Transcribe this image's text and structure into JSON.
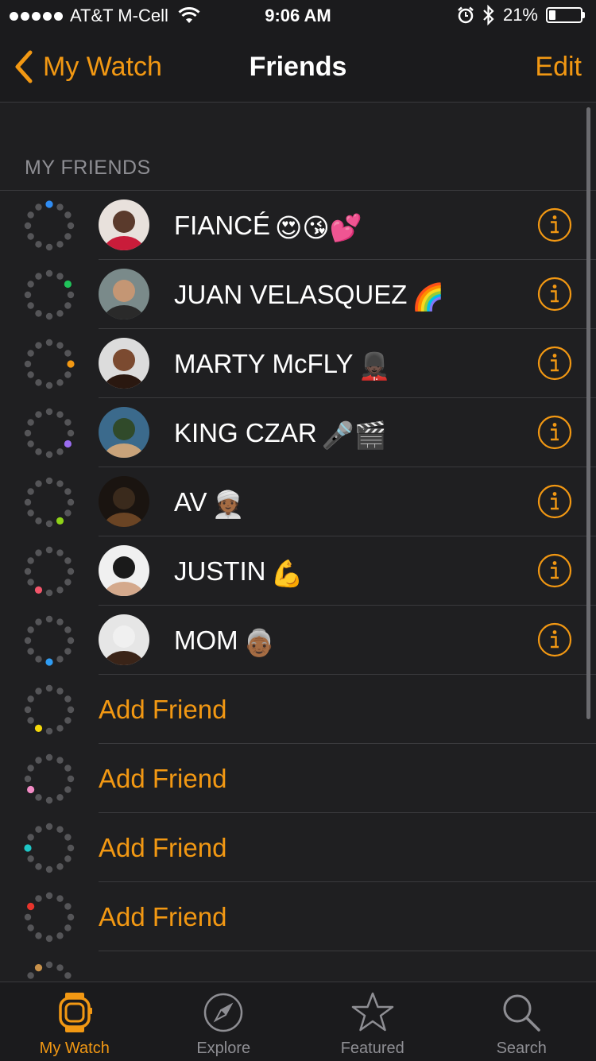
{
  "status_bar": {
    "carrier": "AT&T M-Cell",
    "time": "9:06 AM",
    "battery": "21%",
    "battery_level": 0.21,
    "icons": [
      "signal-dots",
      "wifi-icon",
      "alarm-icon",
      "bluetooth-icon",
      "battery-icon"
    ]
  },
  "nav": {
    "back_label": "My Watch",
    "title": "Friends",
    "edit_label": "Edit"
  },
  "section": {
    "header": "MY FRIENDS"
  },
  "friends": [
    {
      "name": "FIANCÉ",
      "emoji": "😍😘💕",
      "ring_color": "#2f8cf3"
    },
    {
      "name": "JUAN VELASQUEZ",
      "emoji": "🌈",
      "ring_color": "#20c35a"
    },
    {
      "name": "MARTY McFLY",
      "emoji": "💂🏿",
      "ring_color": "#f29813"
    },
    {
      "name": "KING CZAR",
      "emoji": "🎤🎬",
      "ring_color": "#9a6cf0"
    },
    {
      "name": "AV",
      "emoji": "👳🏾",
      "ring_color": "#8fd318"
    },
    {
      "name": "JUSTIN",
      "emoji": "💪",
      "ring_color": "#f2556a"
    },
    {
      "name": "MOM",
      "emoji": "👵🏾",
      "ring_color": "#2f9cf3"
    }
  ],
  "add_friend_slots": [
    {
      "label": "Add Friend",
      "ring_color": "#f5d90a"
    },
    {
      "label": "Add Friend",
      "ring_color": "#f28bc5"
    },
    {
      "label": "Add Friend",
      "ring_color": "#1ec6c6"
    },
    {
      "label": "Add Friend",
      "ring_color": "#e8342c"
    },
    {
      "label": "",
      "ring_color": "#c8914a"
    }
  ],
  "tabs": [
    {
      "label": "My Watch",
      "icon": "watch-icon",
      "active": true
    },
    {
      "label": "Explore",
      "icon": "compass-icon",
      "active": false
    },
    {
      "label": "Featured",
      "icon": "star-icon",
      "active": false
    },
    {
      "label": "Search",
      "icon": "search-icon",
      "active": false
    }
  ],
  "colors": {
    "accent": "#f29813",
    "background": "#1f1f21",
    "separator": "#3a3a3d",
    "secondary_text": "#8e8e93"
  }
}
